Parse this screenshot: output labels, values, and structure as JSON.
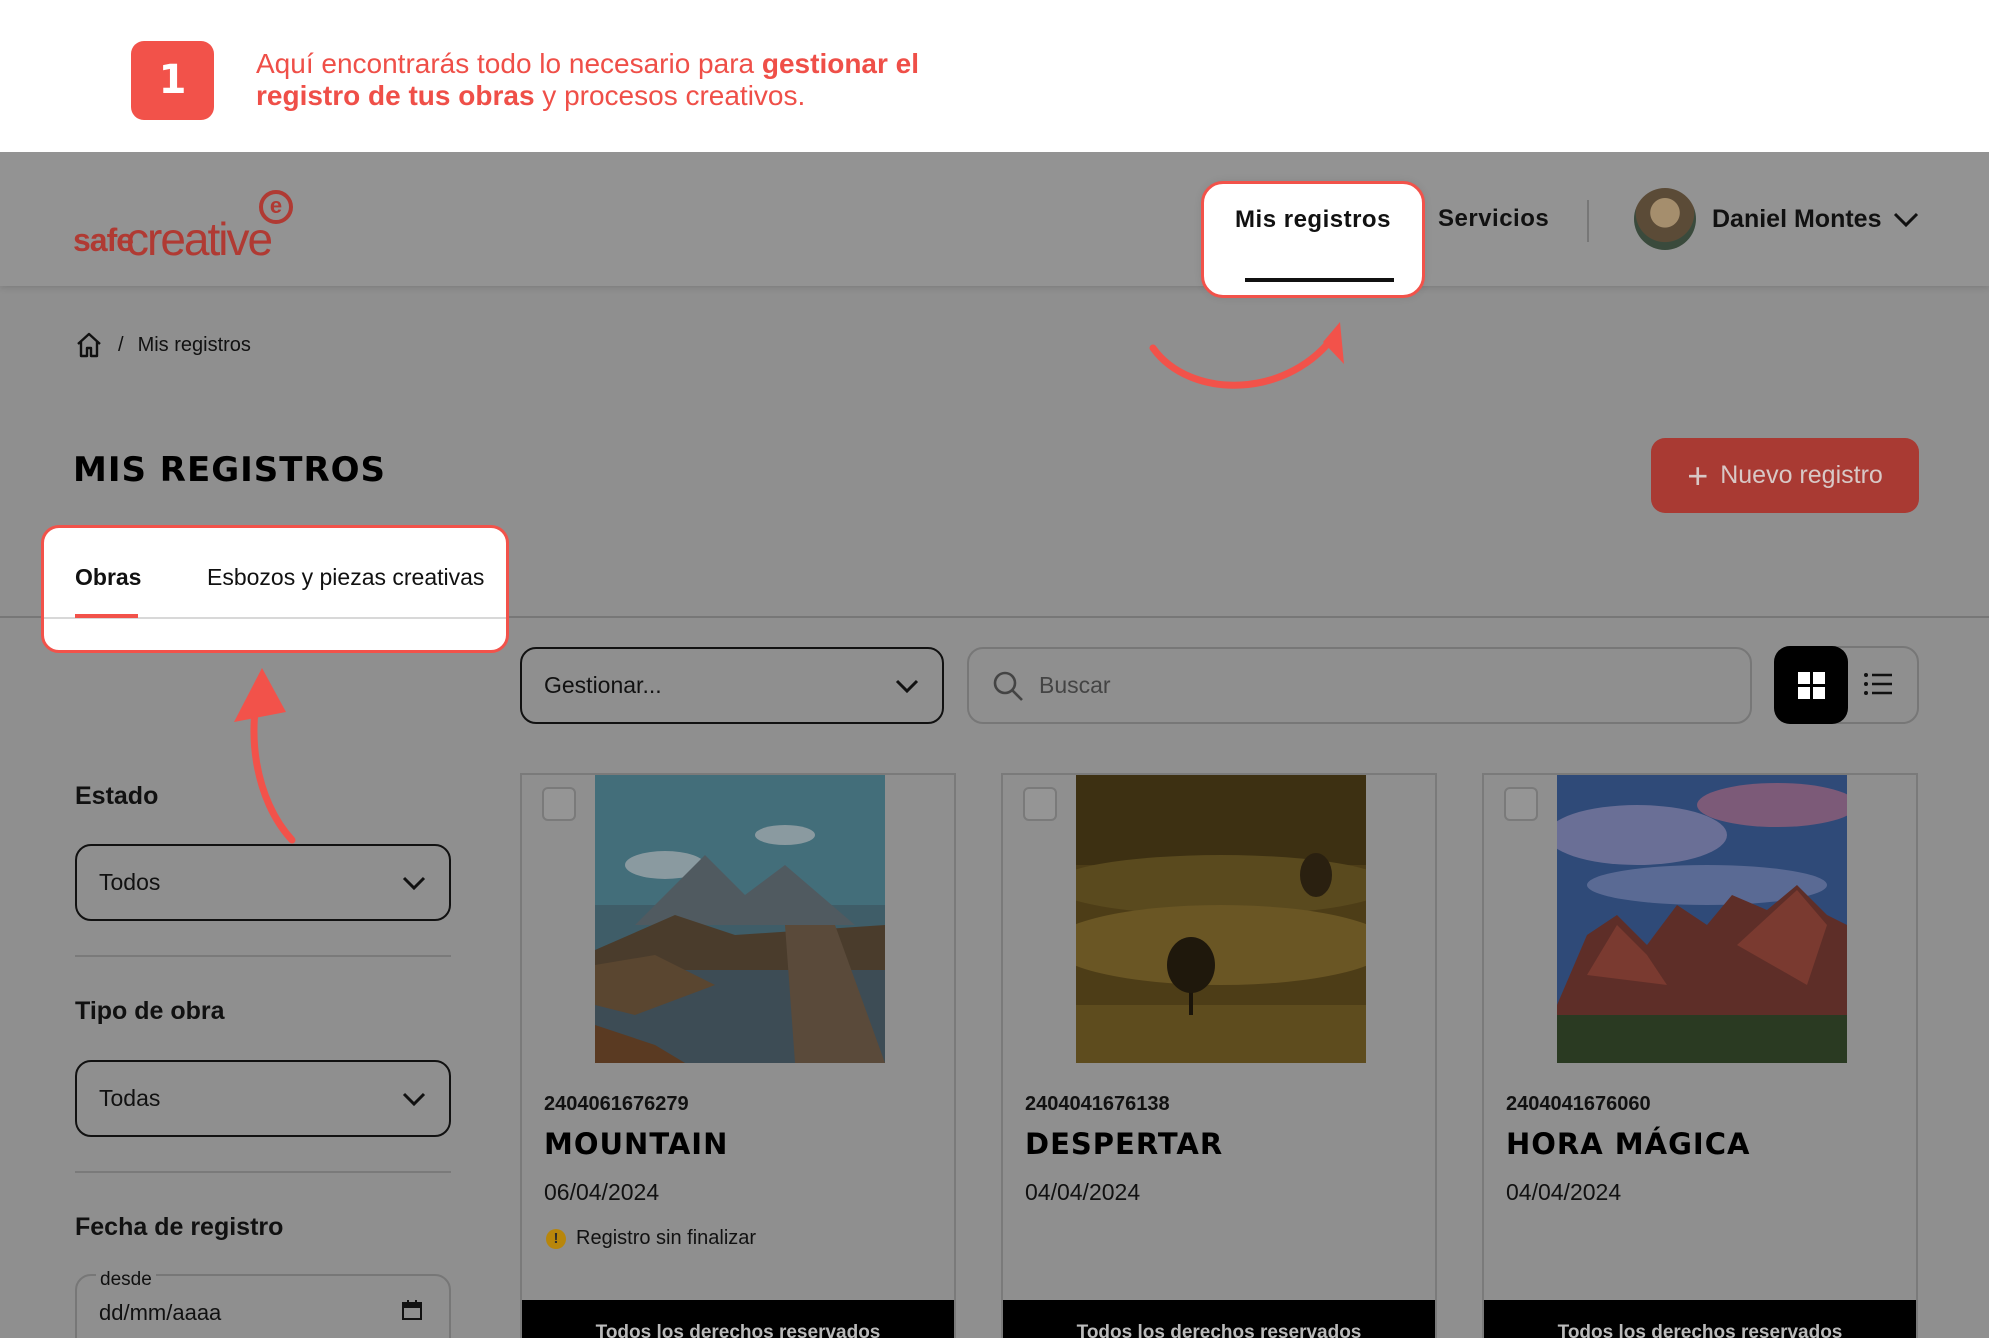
{
  "tutorial": {
    "step_number": "1",
    "text_part1": "Aquí encontrarás todo lo necesario para ",
    "text_bold": "gestionar el registro de tus obras",
    "text_part2": " y procesos creativos.",
    "accent_color": "#f2524a"
  },
  "header": {
    "logo_safe": "safe",
    "logo_creative": "creative",
    "nav": {
      "mis_registros": "Mis registros",
      "servicios": "Servicios"
    },
    "user_name": "Daniel Montes"
  },
  "breadcrumb": {
    "separator": "/",
    "current": "Mis registros"
  },
  "page": {
    "title": "MIS REGISTROS",
    "new_button": "Nuevo registro"
  },
  "tabs": [
    {
      "label": "Obras",
      "active": true
    },
    {
      "label": "Esbozos y piezas creativas",
      "active": false
    }
  ],
  "toolbar": {
    "manage_select": "Gestionar...",
    "search_placeholder": "Buscar",
    "view_mode": "grid"
  },
  "filters": {
    "estado": {
      "label": "Estado",
      "value": "Todos"
    },
    "tipo": {
      "label": "Tipo de obra",
      "value": "Todas"
    },
    "fecha": {
      "label": "Fecha de registro",
      "from_label": "desde",
      "from_placeholder": "dd/mm/aaaa"
    }
  },
  "cards": [
    {
      "code": "2404061676279",
      "title": "MOUNTAIN",
      "date": "06/04/2024",
      "status": "Registro sin finalizar",
      "footer": "Todos los derechos reservados"
    },
    {
      "code": "2404041676138",
      "title": "DESPERTAR",
      "date": "04/04/2024",
      "status": "",
      "footer": "Todos los derechos reservados"
    },
    {
      "code": "2404041676060",
      "title": "HORA MÁGICA",
      "date": "04/04/2024",
      "status": "",
      "footer": "Todos los derechos reservados"
    }
  ]
}
